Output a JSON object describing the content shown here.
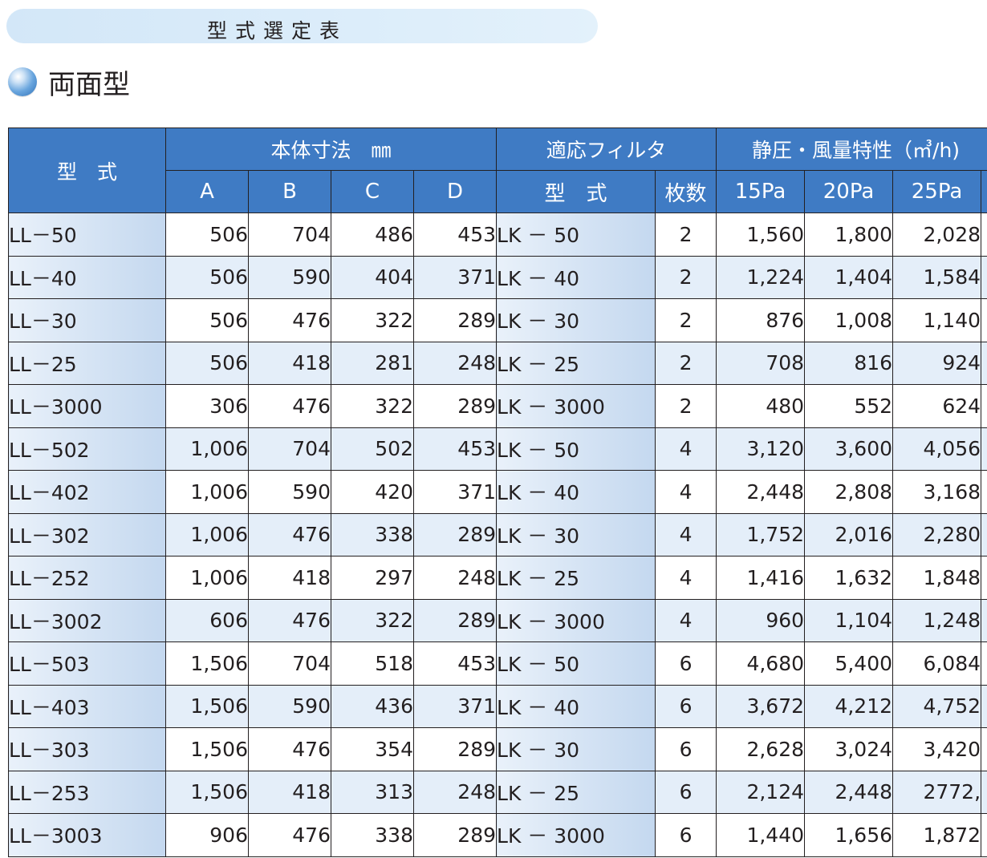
{
  "banner": {
    "title": "型式選定表"
  },
  "section": {
    "title": "両面型"
  },
  "table": {
    "header": {
      "model": "型　式",
      "dimensions": "本体寸法　㎜",
      "filter": "適応フィルタ",
      "airflow": "静圧・風量特性（㎥/h)",
      "dim_cols": [
        "A",
        "B",
        "C",
        "D"
      ],
      "filter_model": "型　式",
      "filter_count": "枚数",
      "pressure_cols": [
        "15Pa",
        "20Pa",
        "25Pa"
      ]
    },
    "rows": [
      {
        "model": "LL－50",
        "a": "506",
        "b": "704",
        "c": "486",
        "d": "453",
        "filter": "LK － 50",
        "count": "2",
        "p15": "1,560",
        "p20": "1,800",
        "p25": "2,028"
      },
      {
        "model": "LL－40",
        "a": "506",
        "b": "590",
        "c": "404",
        "d": "371",
        "filter": "LK － 40",
        "count": "2",
        "p15": "1,224",
        "p20": "1,404",
        "p25": "1,584"
      },
      {
        "model": "LL－30",
        "a": "506",
        "b": "476",
        "c": "322",
        "d": "289",
        "filter": "LK － 30",
        "count": "2",
        "p15": "876",
        "p20": "1,008",
        "p25": "1,140"
      },
      {
        "model": "LL－25",
        "a": "506",
        "b": "418",
        "c": "281",
        "d": "248",
        "filter": "LK － 25",
        "count": "2",
        "p15": "708",
        "p20": "816",
        "p25": "924"
      },
      {
        "model": "LL－3000",
        "a": "306",
        "b": "476",
        "c": "322",
        "d": "289",
        "filter": "LK － 3000",
        "count": "2",
        "p15": "480",
        "p20": "552",
        "p25": "624"
      },
      {
        "model": "LL－502",
        "a": "1,006",
        "b": "704",
        "c": "502",
        "d": "453",
        "filter": "LK － 50",
        "count": "4",
        "p15": "3,120",
        "p20": "3,600",
        "p25": "4,056"
      },
      {
        "model": "LL－402",
        "a": "1,006",
        "b": "590",
        "c": "420",
        "d": "371",
        "filter": "LK － 40",
        "count": "4",
        "p15": "2,448",
        "p20": "2,808",
        "p25": "3,168"
      },
      {
        "model": "LL－302",
        "a": "1,006",
        "b": "476",
        "c": "338",
        "d": "289",
        "filter": "LK － 30",
        "count": "4",
        "p15": "1,752",
        "p20": "2,016",
        "p25": "2,280"
      },
      {
        "model": "LL－252",
        "a": "1,006",
        "b": "418",
        "c": "297",
        "d": "248",
        "filter": "LK － 25",
        "count": "4",
        "p15": "1,416",
        "p20": "1,632",
        "p25": "1,848"
      },
      {
        "model": "LL－3002",
        "a": "606",
        "b": "476",
        "c": "322",
        "d": "289",
        "filter": "LK － 3000",
        "count": "4",
        "p15": "960",
        "p20": "1,104",
        "p25": "1,248"
      },
      {
        "model": "LL－503",
        "a": "1,506",
        "b": "704",
        "c": "518",
        "d": "453",
        "filter": "LK － 50",
        "count": "6",
        "p15": "4,680",
        "p20": "5,400",
        "p25": "6,084"
      },
      {
        "model": "LL－403",
        "a": "1,506",
        "b": "590",
        "c": "436",
        "d": "371",
        "filter": "LK － 40",
        "count": "6",
        "p15": "3,672",
        "p20": "4,212",
        "p25": "4,752"
      },
      {
        "model": "LL－303",
        "a": "1,506",
        "b": "476",
        "c": "354",
        "d": "289",
        "filter": "LK － 30",
        "count": "6",
        "p15": "2,628",
        "p20": "3,024",
        "p25": "3,420"
      },
      {
        "model": "LL－253",
        "a": "1,506",
        "b": "418",
        "c": "313",
        "d": "248",
        "filter": "LK － 25",
        "count": "6",
        "p15": "2,124",
        "p20": "2,448",
        "p25": "2772,"
      },
      {
        "model": "LL－3003",
        "a": "906",
        "b": "476",
        "c": "338",
        "d": "289",
        "filter": "LK － 3000",
        "count": "6",
        "p15": "1,440",
        "p20": "1,656",
        "p25": "1,872"
      }
    ]
  }
}
